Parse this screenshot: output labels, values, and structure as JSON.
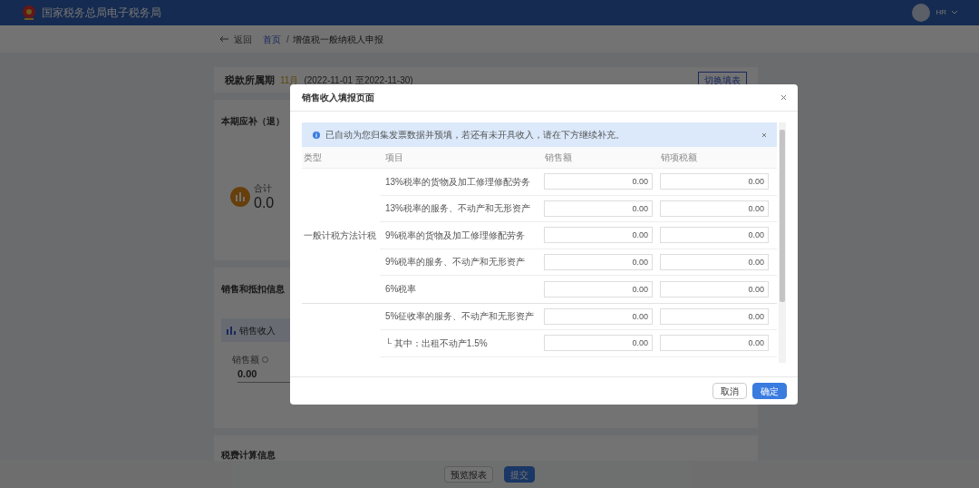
{
  "header": {
    "title": "国家税务总局电子税务局",
    "user": "HR"
  },
  "breadcrumb": {
    "back": "返回",
    "separator": "/",
    "items": [
      {
        "label": "首页",
        "link": true
      },
      {
        "label": "增值税一般纳税人申报",
        "link": false
      }
    ]
  },
  "period": {
    "label": "税款所属期",
    "month": "11月",
    "range": "(2022-11-01 至2022-11-30)",
    "button": "切换填表"
  },
  "summary": {
    "title": "本期应补（退）",
    "total_label": "合计",
    "total_value": "0.0"
  },
  "sales": {
    "title": "销售和抵扣信息",
    "tab": "销售收入",
    "field_label": "销售额",
    "field_value": "0.00"
  },
  "calc": {
    "title": "税费计算信息"
  },
  "footer_buttons": [
    {
      "label": "预览报表",
      "kind": "default"
    },
    {
      "label": "提交",
      "kind": "primary"
    }
  ],
  "dialog": {
    "title": "销售收入填报页面",
    "alert": "已自动为您归集发票数据并预填，若还有未开具收入，请在下方继续补充。",
    "columns": [
      "类型",
      "项目",
      "销售额",
      "销项税额"
    ],
    "groups": [
      {
        "type": "一般计税方法计税",
        "rows": [
          {
            "item": "13%税率的货物及加工修理修配劳务",
            "sales": "0.00",
            "tax": "0.00"
          },
          {
            "item": "13%税率的服务、不动产和无形资产",
            "sales": "0.00",
            "tax": "0.00"
          },
          {
            "item": "9%税率的货物及加工修理修配劳务",
            "sales": "0.00",
            "tax": "0.00"
          },
          {
            "item": "9%税率的服务、不动产和无形资产",
            "sales": "0.00",
            "tax": "0.00"
          },
          {
            "item": "6%税率",
            "sales": "0.00",
            "tax": "0.00"
          }
        ]
      },
      {
        "rows": [
          {
            "item": "5%征收率的服务、不动产和无形资产",
            "sales": "0.00",
            "tax": "0.00"
          },
          {
            "item": "└ 其中：出租不动产1.5%",
            "sales": "0.00",
            "tax": "0.00"
          }
        ]
      }
    ],
    "buttons": [
      {
        "label": "取消",
        "kind": "default"
      },
      {
        "label": "确定",
        "kind": "primary"
      }
    ]
  }
}
